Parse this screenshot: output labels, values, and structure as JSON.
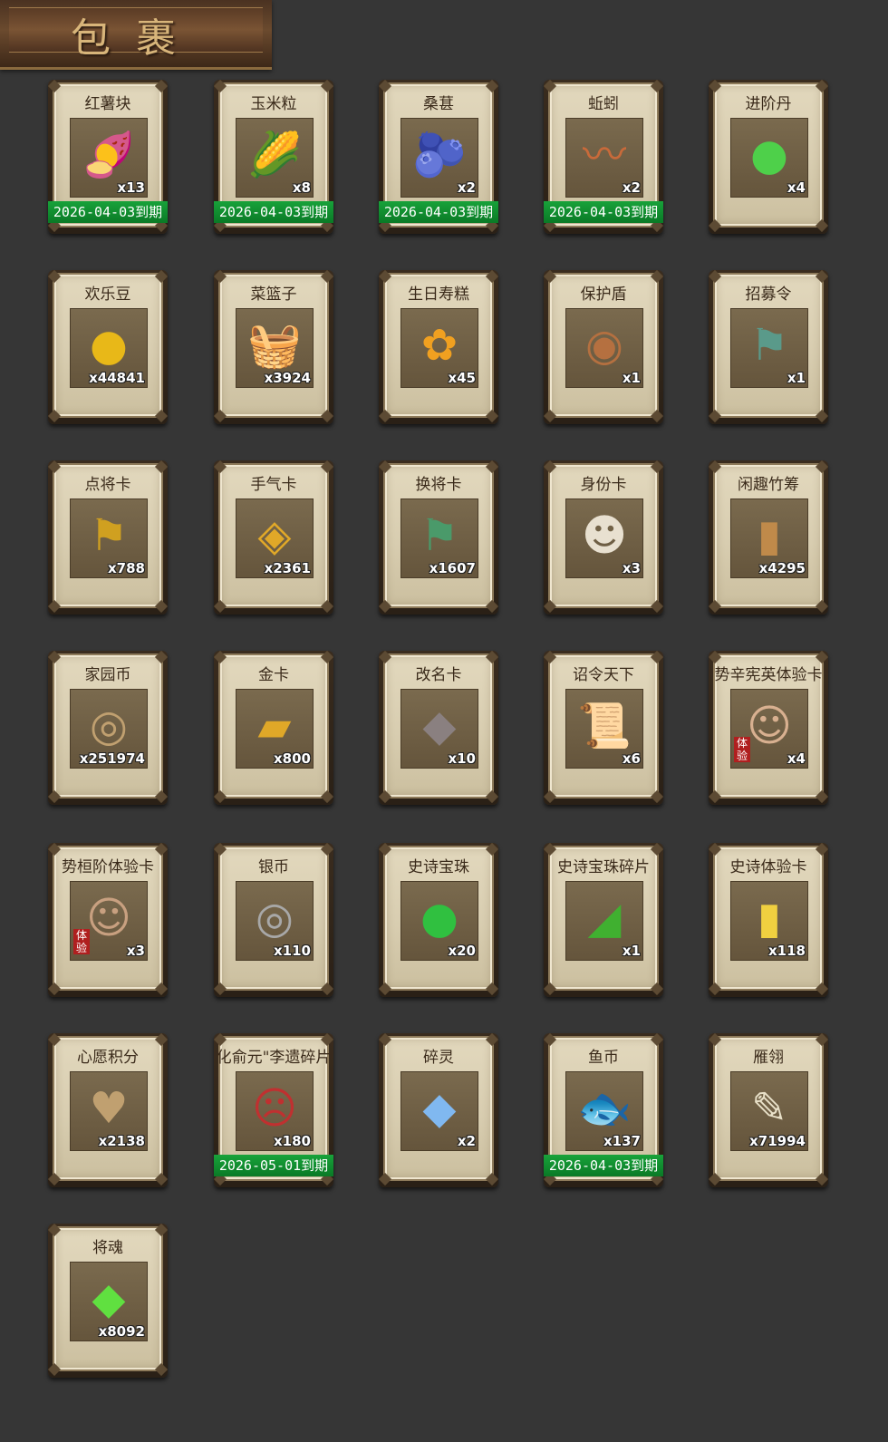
{
  "header": {
    "title": "包裹"
  },
  "items": [
    {
      "name": "红薯块",
      "qty": "x13",
      "expire": "2026-04-03到期",
      "icon": "sweet-potato-icon",
      "glyph": "🍠",
      "color": "#d8781e"
    },
    {
      "name": "玉米粒",
      "qty": "x8",
      "expire": "2026-04-03到期",
      "icon": "corn-icon",
      "glyph": "🌽",
      "color": "#e0b020"
    },
    {
      "name": "桑葚",
      "qty": "x2",
      "expire": "2026-04-03到期",
      "icon": "mulberry-icon",
      "glyph": "🫐",
      "color": "#3a4ab0"
    },
    {
      "name": "蚯蚓",
      "qty": "x2",
      "expire": "2026-04-03到期",
      "icon": "earthworm-icon",
      "glyph": "〰",
      "color": "#c86a3a"
    },
    {
      "name": "进阶丹",
      "qty": "x4",
      "expire": "",
      "icon": "advance-pill-icon",
      "glyph": "●",
      "color": "#4ed04a"
    },
    {
      "name": "欢乐豆",
      "qty": "x44841",
      "expire": "",
      "icon": "happy-beans-icon",
      "glyph": "●",
      "color": "#e8b818"
    },
    {
      "name": "菜篮子",
      "qty": "x3924",
      "expire": "",
      "icon": "vegetable-basket-icon",
      "glyph": "🧺",
      "color": "#c9962e"
    },
    {
      "name": "生日寿糕",
      "qty": "x45",
      "expire": "",
      "icon": "birthday-cake-icon",
      "glyph": "✿",
      "color": "#f0a020"
    },
    {
      "name": "保护盾",
      "qty": "x1",
      "expire": "",
      "icon": "shield-icon",
      "glyph": "◉",
      "color": "#b57040"
    },
    {
      "name": "招募令",
      "qty": "x1",
      "expire": "",
      "icon": "recruit-token-icon",
      "glyph": "⚑",
      "color": "#5a9a8a"
    },
    {
      "name": "点将卡",
      "qty": "x788",
      "expire": "",
      "icon": "general-pick-card-icon",
      "glyph": "⚑",
      "color": "#d0a020"
    },
    {
      "name": "手气卡",
      "qty": "x2361",
      "expire": "",
      "icon": "luck-card-icon",
      "glyph": "◈",
      "color": "#e0a828"
    },
    {
      "name": "换将卡",
      "qty": "x1607",
      "expire": "",
      "icon": "swap-general-card-icon",
      "glyph": "⚑",
      "color": "#4a9a6a"
    },
    {
      "name": "身份卡",
      "qty": "x3",
      "expire": "",
      "icon": "identity-card-icon",
      "glyph": "☻",
      "color": "#e8e0d0"
    },
    {
      "name": "闲趣竹筹",
      "qty": "x4295",
      "expire": "",
      "icon": "bamboo-token-icon",
      "glyph": "▮",
      "color": "#c08a4a"
    },
    {
      "name": "家园币",
      "qty": "x251974",
      "expire": "",
      "icon": "home-coin-icon",
      "glyph": "◎",
      "color": "#c0a070"
    },
    {
      "name": "金卡",
      "qty": "x800",
      "expire": "",
      "icon": "gold-card-icon",
      "glyph": "▰",
      "color": "#e0a828"
    },
    {
      "name": "改名卡",
      "qty": "x10",
      "expire": "",
      "icon": "rename-card-icon",
      "glyph": "◆",
      "color": "#8a8080"
    },
    {
      "name": "诏令天下",
      "qty": "x6",
      "expire": "",
      "icon": "imperial-edict-icon",
      "glyph": "📜",
      "color": "#d04020"
    },
    {
      "name": "势辛宪英体验卡",
      "qty": "x4",
      "expire": "",
      "icon": "xin-xianying-portrait-icon",
      "glyph": "☺",
      "color": "#d8b090",
      "badge": "体验"
    },
    {
      "name": "势桓阶体验卡",
      "qty": "x3",
      "expire": "",
      "icon": "huan-jie-portrait-icon",
      "glyph": "☺",
      "color": "#c8a080",
      "badge": "体验"
    },
    {
      "name": "银币",
      "qty": "x110",
      "expire": "",
      "icon": "silver-coin-icon",
      "glyph": "◎",
      "color": "#a8a8a8"
    },
    {
      "name": "史诗宝珠",
      "qty": "x20",
      "expire": "",
      "icon": "epic-orb-icon",
      "glyph": "●",
      "color": "#30c040"
    },
    {
      "name": "史诗宝珠碎片",
      "qty": "x1",
      "expire": "",
      "icon": "epic-orb-shard-icon",
      "glyph": "◢",
      "color": "#40b030"
    },
    {
      "name": "史诗体验卡",
      "qty": "x118",
      "expire": "",
      "icon": "epic-trial-card-icon",
      "glyph": "▮",
      "color": "#f0d040"
    },
    {
      "name": "心愿积分",
      "qty": "x2138",
      "expire": "",
      "icon": "wish-points-icon",
      "glyph": "♥",
      "color": "#c0a070"
    },
    {
      "name": "化俞元\"李遗碎片",
      "qty": "x180",
      "expire": "2026-05-01到期",
      "icon": "general-shard-portrait-icon",
      "glyph": "☹",
      "color": "#c03030"
    },
    {
      "name": "碎灵",
      "qty": "x2",
      "expire": "",
      "icon": "spirit-shard-icon",
      "glyph": "◆",
      "color": "#80b8f0"
    },
    {
      "name": "鱼币",
      "qty": "x137",
      "expire": "2026-04-03到期",
      "icon": "fish-coin-icon",
      "glyph": "🐟",
      "color": "#e8b020"
    },
    {
      "name": "雁翎",
      "qty": "x71994",
      "expire": "",
      "icon": "goose-feather-icon",
      "glyph": "✎",
      "color": "#e8e0c8"
    },
    {
      "name": "将魂",
      "qty": "x8092",
      "expire": "",
      "icon": "general-soul-icon",
      "glyph": "◆",
      "color": "#60e040"
    }
  ]
}
